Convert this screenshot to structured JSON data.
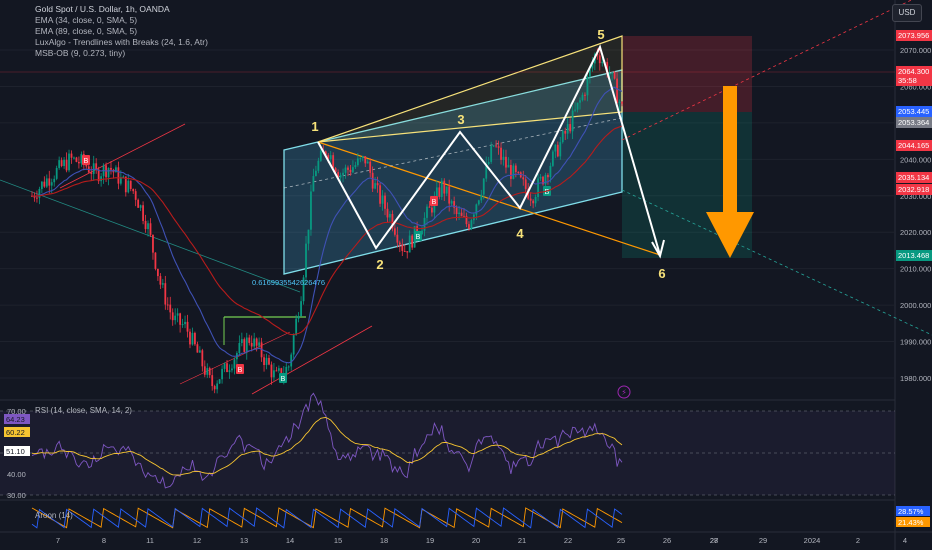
{
  "header": {
    "title": "Gold Spot / U.S. Dollar, 1h, OANDA",
    "indicators": [
      "EMA (34, close, 0, SMA, 5)",
      "EMA (89, close, 0, SMA, 5)",
      "LuxAlgo - Trendlines with Breaks (24, 1.6, Atr)",
      "MSB-OB (9, 0.273, tiny)"
    ],
    "currency_button": "USD"
  },
  "chart_data": [
    {
      "type": "candlestick",
      "title": "Gold Spot / U.S. Dollar, 1h, OANDA",
      "y_ticks": [
        "2070.000",
        "2060.000",
        "2050.000",
        "2040.000",
        "2030.000",
        "2020.000",
        "2010.000",
        "2000.000",
        "1990.000",
        "1980.000"
      ],
      "ylim": [
        1975,
        2078
      ],
      "x_ticks": [
        "7",
        "8",
        "11",
        "12",
        "13",
        "14",
        "15",
        "18",
        "19",
        "20",
        "21",
        "22",
        "25",
        "26",
        "27",
        "28",
        "29",
        "2024",
        "2",
        "4"
      ],
      "price_path": [
        2030,
        2034,
        2037,
        2040,
        2039,
        2036,
        2038,
        2034,
        2031,
        2022,
        2006,
        1996,
        1994,
        1986,
        1978,
        1982,
        1987,
        1991,
        1986,
        1980,
        1983,
        2004,
        2037,
        2043,
        2036,
        2038,
        2040,
        2030,
        2024,
        2015,
        2020,
        2026,
        2033,
        2025,
        2022,
        2032,
        2044,
        2038,
        2034,
        2030,
        2036,
        2043,
        2050,
        2058,
        2070,
        2064,
        2054
      ],
      "price_labels": [
        {
          "text": "2073.956",
          "color": "#f23645"
        },
        {
          "text": "2064.300",
          "sub": "35:58",
          "color": "#f23645"
        },
        {
          "text": "2053.445",
          "color": "#2962ff"
        },
        {
          "text": "2053.364",
          "color": "#787b86"
        },
        {
          "text": "2044.165",
          "color": "#f23645"
        },
        {
          "text": "2035.134",
          "color": "#f23645"
        },
        {
          "text": "2032.918",
          "color": "#f23645"
        },
        {
          "text": "2013.468",
          "color": "#089981"
        }
      ],
      "wave_labels": [
        "1",
        "2",
        "3",
        "4",
        "5",
        "6"
      ],
      "fib_label": "0.6169935542626476",
      "signal_tags": [
        "B",
        "B",
        "B",
        "B",
        "B",
        "B"
      ]
    },
    {
      "type": "line",
      "title": "RSI (14, close, SMA, 14, 2)",
      "y_ticks": [
        "70.00",
        "60.00",
        "40.00",
        "30.00"
      ],
      "ylim": [
        28,
        72
      ],
      "value_badges": [
        {
          "text": "64.23",
          "color": "#7e57c2"
        },
        {
          "text": "60.22",
          "color": "#f7c531"
        },
        {
          "text": "51.10",
          "color": "#ffffff"
        }
      ]
    },
    {
      "type": "line",
      "title": "Aroon (14)",
      "value_badges": [
        {
          "text": "28.57%",
          "color": "#2962ff"
        },
        {
          "text": "21.43%",
          "color": "#ff9800"
        }
      ]
    }
  ]
}
